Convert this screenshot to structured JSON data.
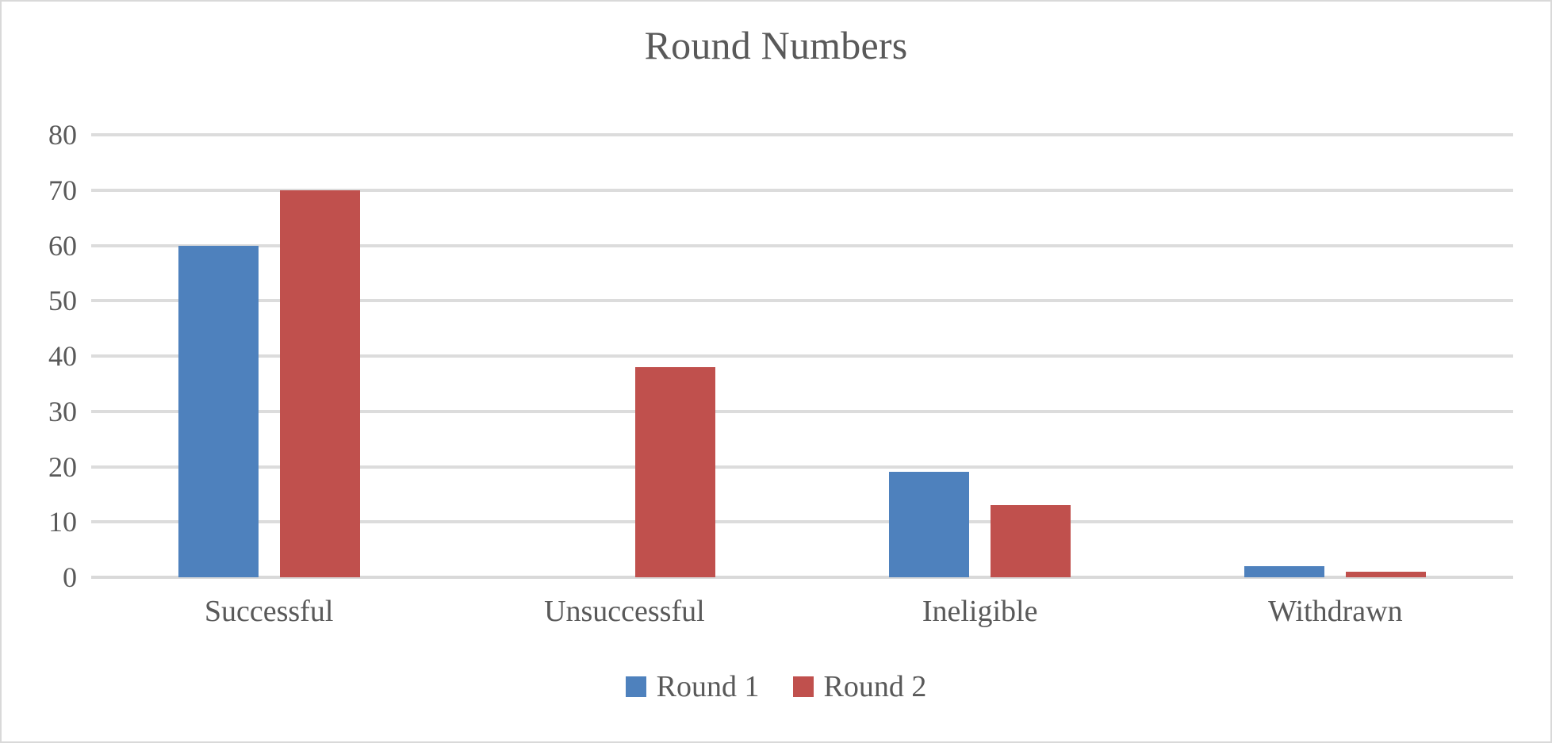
{
  "chart_data": {
    "type": "bar",
    "title": "Round Numbers",
    "xlabel": "",
    "ylabel": "",
    "categories": [
      "Successful",
      "Unsuccessful",
      "Ineligible",
      "Withdrawn"
    ],
    "series": [
      {
        "name": "Round 1",
        "color": "#4E81BD",
        "values": [
          60,
          0,
          19,
          2
        ]
      },
      {
        "name": "Round 2",
        "color": "#C0504D",
        "values": [
          70,
          38,
          13,
          1
        ]
      }
    ],
    "ylim": [
      0,
      80
    ],
    "ytick_step": 10,
    "ytick_labels": [
      "80",
      "70",
      "60",
      "50",
      "40",
      "30",
      "20",
      "10",
      "0"
    ],
    "ytick_values": [
      80,
      70,
      60,
      50,
      40,
      30,
      20,
      10,
      0
    ],
    "grid": true,
    "grid_axis": "y",
    "grid_color": "#dcdcdc",
    "legend_position": "bottom",
    "legend_entries": [
      "Round 1",
      "Round 2"
    ],
    "background": "#ffffff",
    "border_color": "#d9d9d9",
    "text_color": "#595959"
  }
}
